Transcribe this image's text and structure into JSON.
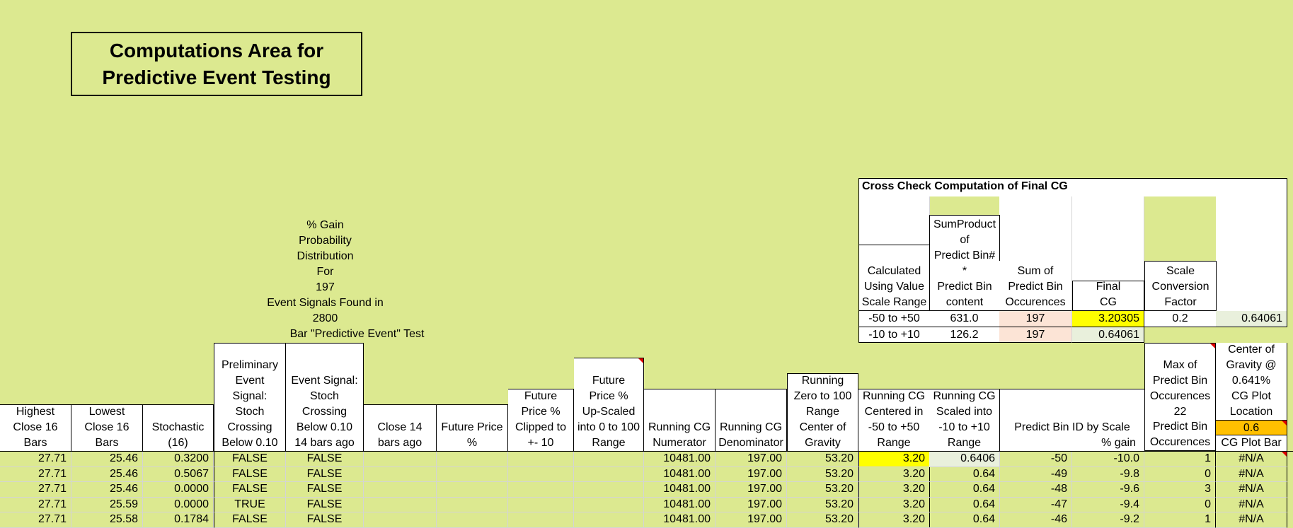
{
  "title": {
    "line1": "Computations Area for",
    "line2": "Predictive Event Testing"
  },
  "prob_note": [
    "% Gain",
    "Probability",
    "Distribution",
    "For",
    "197",
    "Event Signals Found in",
    "2800",
    "Bar \"Predictive Event\" Test"
  ],
  "cross_check": {
    "title": "Cross Check Computation of Final CG",
    "headers": {
      "calc": [
        "Calculated",
        "Using Value",
        "Scale Range"
      ],
      "sumproduct": [
        "SumProduct",
        "of",
        "Predict Bin#",
        "*",
        "Predict Bin",
        "content"
      ],
      "sum_occ": [
        "Sum of",
        "Predict Bin",
        "Occurences"
      ],
      "final_cg": [
        "Final",
        "CG"
      ],
      "scale": [
        "Scale",
        "Conversion",
        "Factor"
      ]
    },
    "row1": {
      "range": "-50 to +50",
      "sumproduct": "631.0",
      "occ": "197",
      "final_cg": "3.20305",
      "scale": "0.2",
      "result": "0.64061"
    },
    "row2": {
      "range": "-10 to +10",
      "sumproduct": "126.2",
      "occ": "197",
      "final_cg": "0.64061"
    }
  },
  "headers": {
    "highest": [
      "Highest",
      "Close 16",
      "Bars"
    ],
    "lowest": [
      "Lowest",
      "Close 16",
      "Bars"
    ],
    "stoch": [
      "Stochastic",
      "(16)"
    ],
    "prelim": [
      "Preliminary",
      "Event",
      "Signal:",
      "Stoch",
      "Crossing",
      "Below 0.10"
    ],
    "event": [
      "Event Signal:",
      "Stoch",
      "Crossing",
      "Below 0.10",
      "14 bars ago"
    ],
    "close14": [
      "Close 14",
      "bars ago"
    ],
    "future_pct": [
      "Future Price",
      "%"
    ],
    "clipped": [
      "Future",
      "Price %",
      "Clipped to",
      "+- 10"
    ],
    "upscaled": [
      "Future",
      "Price %",
      "Up-Scaled",
      "into 0 to 100",
      "Range"
    ],
    "cg_num": [
      "Running CG",
      "Numerator"
    ],
    "cg_den": [
      "Running CG",
      "Denominator"
    ],
    "zero100": [
      "Running",
      "Zero to 100",
      "Range",
      "Center of",
      "Gravity"
    ],
    "centered": [
      "Running CG",
      "Centered in",
      "-50 to +50",
      "Range"
    ],
    "scaled": [
      "Running CG",
      "Scaled into",
      "-10 to +10",
      "Range"
    ],
    "bin_id": "Predict Bin ID by Scale",
    "pct_gain": "% gain",
    "max_occ": [
      "Max of",
      "Predict Bin",
      "Occurences"
    ],
    "max_occ_val": "22",
    "pred_occ": [
      "Predict Bin",
      "Occurences"
    ],
    "cog": [
      "Center of",
      "Gravity @",
      "0.641%",
      "CG Plot",
      "Location"
    ],
    "cog_val": "0.6",
    "plot_bar": "CG Plot Bar"
  },
  "rows": [
    {
      "highest": "27.71",
      "lowest": "25.46",
      "stoch": "0.3200",
      "prelim": "FALSE",
      "event": "FALSE",
      "num": "10481.00",
      "den": "197.00",
      "zero100": "53.20",
      "centered": "3.20",
      "scaled": "0.6406",
      "bin": "-50",
      "gain": "-10.0",
      "occ": "1",
      "plot": "#N/A"
    },
    {
      "highest": "27.71",
      "lowest": "25.46",
      "stoch": "0.5067",
      "prelim": "FALSE",
      "event": "FALSE",
      "num": "10481.00",
      "den": "197.00",
      "zero100": "53.20",
      "centered": "3.20",
      "scaled": "0.64",
      "bin": "-49",
      "gain": "-9.8",
      "occ": "0",
      "plot": "#N/A"
    },
    {
      "highest": "27.71",
      "lowest": "25.46",
      "stoch": "0.0000",
      "prelim": "FALSE",
      "event": "FALSE",
      "num": "10481.00",
      "den": "197.00",
      "zero100": "53.20",
      "centered": "3.20",
      "scaled": "0.64",
      "bin": "-48",
      "gain": "-9.6",
      "occ": "3",
      "plot": "#N/A"
    },
    {
      "highest": "27.71",
      "lowest": "25.59",
      "stoch": "0.0000",
      "prelim": "TRUE",
      "event": "FALSE",
      "num": "10481.00",
      "den": "197.00",
      "zero100": "53.20",
      "centered": "3.20",
      "scaled": "0.64",
      "bin": "-47",
      "gain": "-9.4",
      "occ": "0",
      "plot": "#N/A"
    },
    {
      "highest": "27.71",
      "lowest": "25.58",
      "stoch": "0.1784",
      "prelim": "FALSE",
      "event": "FALSE",
      "num": "10481.00",
      "den": "197.00",
      "zero100": "53.20",
      "centered": "3.20",
      "scaled": "0.64",
      "bin": "-46",
      "gain": "-9.2",
      "occ": "1",
      "plot": "#N/A"
    }
  ]
}
